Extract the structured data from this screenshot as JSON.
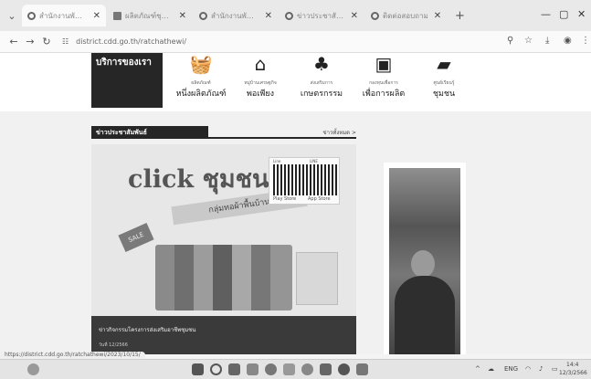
{
  "browser": {
    "tabs": [
      {
        "title": "สำนักงานพัฒนาชุมชน",
        "icon": "chrome-globe-icon",
        "active": true
      },
      {
        "title": "ผลิตภัณฑ์ชุมชน",
        "icon": "page-icon",
        "active": false
      },
      {
        "title": "สำนักงานพัฒนาชุมชนจังหวัด",
        "icon": "chrome-globe-icon",
        "active": false
      },
      {
        "title": "ข่าวประชาสัมพันธ์",
        "icon": "chrome-globe-icon",
        "active": false
      },
      {
        "title": "ติดต่อสอบถาม",
        "icon": "chrome-globe-icon",
        "active": false
      }
    ],
    "address": "district.cdd.go.th/ratchathewi/"
  },
  "services": {
    "title": "บริการของเรา",
    "items": [
      {
        "icon": "basket-icon",
        "sub": "ผลิตภัณฑ์",
        "label": "หนึ่งผลิตภัณฑ์"
      },
      {
        "icon": "home-icon",
        "sub": "หมู่บ้านเศรษฐกิจ",
        "label": "พอเพียง"
      },
      {
        "icon": "tree-icon",
        "sub": "ส่งเสริมการ",
        "label": "เกษตรกรรม"
      },
      {
        "icon": "money-icon",
        "sub": "กองทุนเพื่อการ",
        "label": "เพื่อการผลิต"
      },
      {
        "icon": "book-icon",
        "sub": "ศูนย์เรียนรู้",
        "label": "ชุมชน"
      }
    ]
  },
  "news": {
    "title": "ข่าวประชาสัมพันธ์",
    "more": "ข่าวทั้งหมด >",
    "featured": {
      "brand": "click ชุมชน",
      "ribbon": "กลุ่มทอผ้าพื้นบ้าน",
      "qr_labels": [
        "Line",
        "LINE"
      ],
      "qr_captions": [
        "Play Store",
        "App Store"
      ],
      "tag": "SALE",
      "caption": "ข่าวกิจกรรมโครงการส่งเสริมอาชีพชุมชน",
      "date": "วันที่ 12/2566"
    }
  },
  "status_url": "https://district.cdd.go.th/ratchathewi/2023/10/15/",
  "taskbar": {
    "icons": [
      "windows-icon",
      "search-icon",
      "file-explorer-icon",
      "edge-icon",
      "chrome-icon",
      "mail-icon",
      "settings-icon",
      "word-icon",
      "store-icon"
    ],
    "tray_text": "ENG",
    "time": "14:4",
    "date": "12/3/2566"
  },
  "colors": {
    "dark_header": "#262626",
    "page_bg": "#f1f1f1"
  }
}
